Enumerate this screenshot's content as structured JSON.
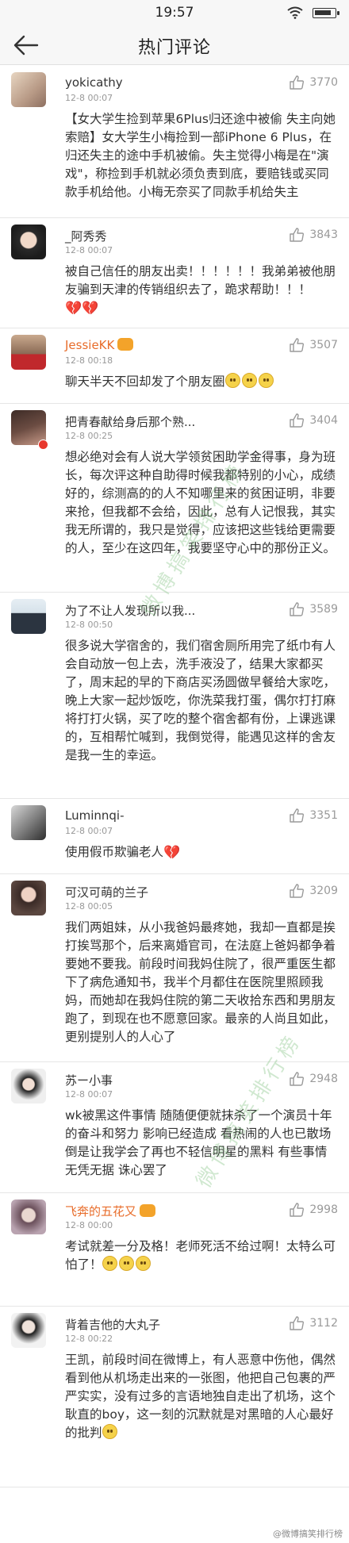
{
  "status": {
    "time": "19:57"
  },
  "nav": {
    "title": "热门评论"
  },
  "comments": [
    {
      "user": "yokicathy",
      "time": "12-8 00:07",
      "likes": "3770",
      "text": "【女大学生捡到苹果6Plus归还途中被偷 失主向她索赔】女大学生小梅捡到一部iPhone 6 Plus，在归还失主的途中手机被偷。失主觉得小梅是在\"演戏\"，称捡到手机就必须负责到底，要赔钱或买同款手机给他。小梅无奈买了同款手机给失主"
    },
    {
      "user": "_阿秀秀",
      "time": "12-8 00:07",
      "likes": "3843",
      "text": "被自己信任的朋友出卖！！！！！！我弟弟被他朋友骗到天津的传销组织去了，跪求帮助！！！"
    },
    {
      "user": "JessieKK",
      "time": "12-8 00:18",
      "likes": "3507",
      "text": "聊天半天不回却发了个朋友圈"
    },
    {
      "user": "把青春献给身后那个熟...",
      "time": "12-8 00:25",
      "likes": "3404",
      "text": "想必绝对会有人说大学领贫困助学金得事，身为班长，每次评这种自助得时候我都特别的小心，成绩好的，综测高的的人不知哪里来的贫困证明，非要来抢，但我都不会给，因此，总有人记恨我，其实我无所谓的，我只是觉得，应该把这些钱给更需要的人，至少在这四年，我要坚守心中的那份正义。"
    },
    {
      "user": "为了不让人发现所以我...",
      "time": "12-8 00:50",
      "likes": "3589",
      "text": "很多说大学宿舍的，我们宿舍厕所用完了纸巾有人会自动放一包上去，洗手液没了，结果大家都买了，周末起的早的下商店买汤圆做早餐给大家吃，晚上大家一起炒饭吃，你洗菜我打蛋，偶尔打打麻将打打火锅，买了吃的整个宿舍都有份，上课逃课的，互相帮忙喊到，我倒觉得，能遇见这样的舍友是我一生的幸运。"
    },
    {
      "user": "Luminnqi-",
      "time": "12-8 00:07",
      "likes": "3351",
      "text": "使用假币欺骗老人"
    },
    {
      "user": "可汉可萌的兰子",
      "time": "12-8 00:05",
      "likes": "3209",
      "text": "我们两姐妹，从小我爸妈最疼她，我却一直都是挨打挨骂那个，后来离婚官司，在法庭上爸妈都争着要她不要我。前段时间我妈住院了，很严重医生都下了病危通知书，我半个月都住在医院里照顾我妈，而她却在我妈住院的第二天收拾东西和男朋友跑了，到现在也不愿意回家。最亲的人尚且如此，更别提别人的人心了"
    },
    {
      "user": "苏ー小事",
      "time": "12-8 00:07",
      "likes": "2948",
      "text": "wk被黑这件事情 随随便便就抹杀了一个演员十年的奋斗和努力 影响已经造成 看热闹的人也已散场 倒是让我学会了再也不轻信明星的黑料 有些事情 无凭无据 诛心罢了"
    },
    {
      "user": "飞奔的五花又",
      "time": "12-8 00:00",
      "likes": "2998",
      "text": "考试就差一分及格！老师死活不给过啊！太特么可怕了！"
    },
    {
      "user": "背着吉他的大丸子",
      "time": "12-8 00:22",
      "likes": "3112",
      "text": "王凯，前段时间在微博上，有人恶意中伤他，偶然看到他从机场走出来的一张图，他把自己包裹的严严实实，没有过多的言语地独自走出了机场，这个耿直的boy，这一刻的沉默就是对黑暗的人心最好的批判"
    }
  ],
  "watermark": {
    "text": "微博搞笑排行榜",
    "footer": "@微博搞笑排行榜"
  }
}
